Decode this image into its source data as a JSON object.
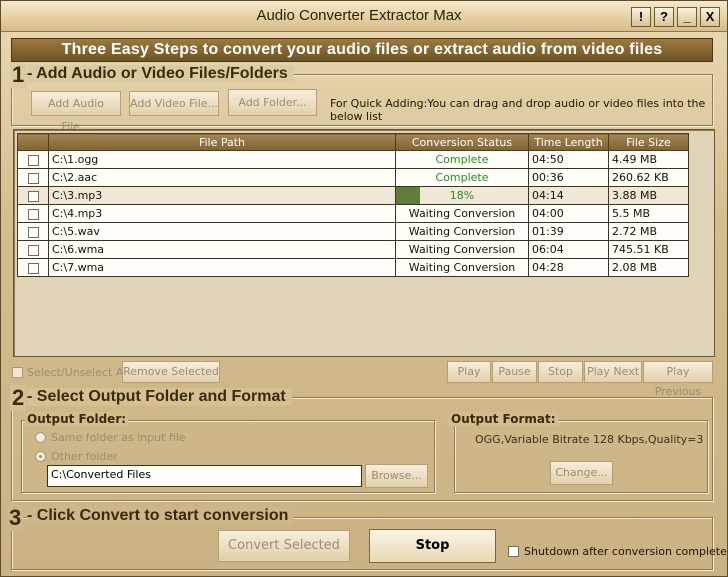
{
  "window": {
    "title": "Audio Converter Extractor Max",
    "controls": [
      "!",
      "?",
      "_",
      "X"
    ]
  },
  "banner": "Three Easy Steps to convert your audio files or extract audio from video files",
  "step1": {
    "number": "1",
    "title": "- Add Audio or Video Files/Folders",
    "buttons": {
      "add_audio": "Add Audio File...",
      "add_video": "Add Video File...",
      "add_folder": "Add Folder..."
    },
    "hint": "For Quick Adding:You can drag and drop audio or video files into the below list",
    "columns": [
      "",
      "File Path",
      "Conversion Status",
      "Time Length",
      "File Size"
    ],
    "files": [
      {
        "path": "C:\\1.ogg",
        "status": "Complete",
        "length": "04:50",
        "size": "4.49 MB",
        "progress": 1.0
      },
      {
        "path": "C:\\2.aac",
        "status": "Complete",
        "length": "00:36",
        "size": "260.62 KB",
        "progress": 1.0
      },
      {
        "path": "C:\\3.mp3",
        "status": "18%",
        "length": "04:14",
        "size": "3.88 MB",
        "progress": 0.18
      },
      {
        "path": "C:\\4.mp3",
        "status": "Waiting Conversion",
        "length": "04:00",
        "size": "5.5 MB",
        "progress": 0
      },
      {
        "path": "C:\\5.wav",
        "status": "Waiting Conversion",
        "length": "01:39",
        "size": "2.72 MB",
        "progress": 0
      },
      {
        "path": "C:\\6.wma",
        "status": "Waiting Conversion",
        "length": "06:04",
        "size": "745.51 KB",
        "progress": 0
      },
      {
        "path": "C:\\7.wma",
        "status": "Waiting Conversion",
        "length": "04:28",
        "size": "2.08 MB",
        "progress": 0
      }
    ],
    "select_all": "Select/Unselect All",
    "remove_selected": "Remove Selected",
    "playback": {
      "play": "Play",
      "pause": "Pause",
      "stop": "Stop",
      "play_next": "Play Next",
      "play_previous": "Play Previous"
    }
  },
  "step2": {
    "number": "2",
    "title": "- Select Output Folder and Format",
    "output_folder_label": "Output Folder:",
    "same_folder": "Same folder as input file",
    "other_folder": "Other folder",
    "folder_path": "C:\\Converted Files",
    "browse": "Browse...",
    "output_format_label": "Output Format:",
    "format_value": "OGG,Variable Bitrate 128 Kbps,Quality=3",
    "change": "Change..."
  },
  "step3": {
    "number": "3",
    "title": "- Click Convert to start conversion",
    "convert_selected": "Convert Selected",
    "stop": "Stop",
    "shutdown": "Shutdown after conversion complete"
  },
  "colors": {
    "banner": "#7f6434",
    "complete_text": "#2f8a25",
    "progress_fill": "#5e7d3a"
  }
}
